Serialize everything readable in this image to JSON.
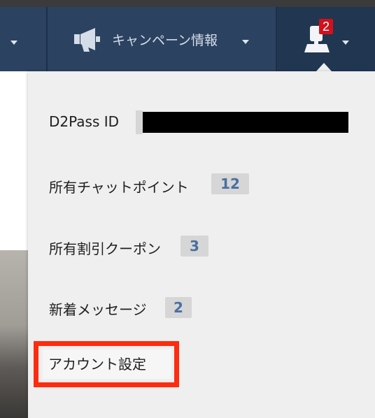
{
  "nav": {
    "campaign_label": "キャンペーン情報",
    "notification_count": "2"
  },
  "menu": {
    "d2pass_label": "D2Pass ID",
    "chat_points_label": "所有チャットポイント",
    "chat_points_value": "12",
    "coupons_label": "所有割引クーポン",
    "coupons_value": "3",
    "messages_label": "新着メッセージ",
    "messages_value": "2",
    "account_settings_label": "アカウント設定"
  },
  "colors": {
    "navbar": "#2b4261",
    "badge": "#d4101b",
    "highlight_border": "#fd2c0f",
    "value_text": "#4a6fa2"
  },
  "icons": [
    "chevron-down-icon",
    "megaphone-icon",
    "user-icon"
  ]
}
